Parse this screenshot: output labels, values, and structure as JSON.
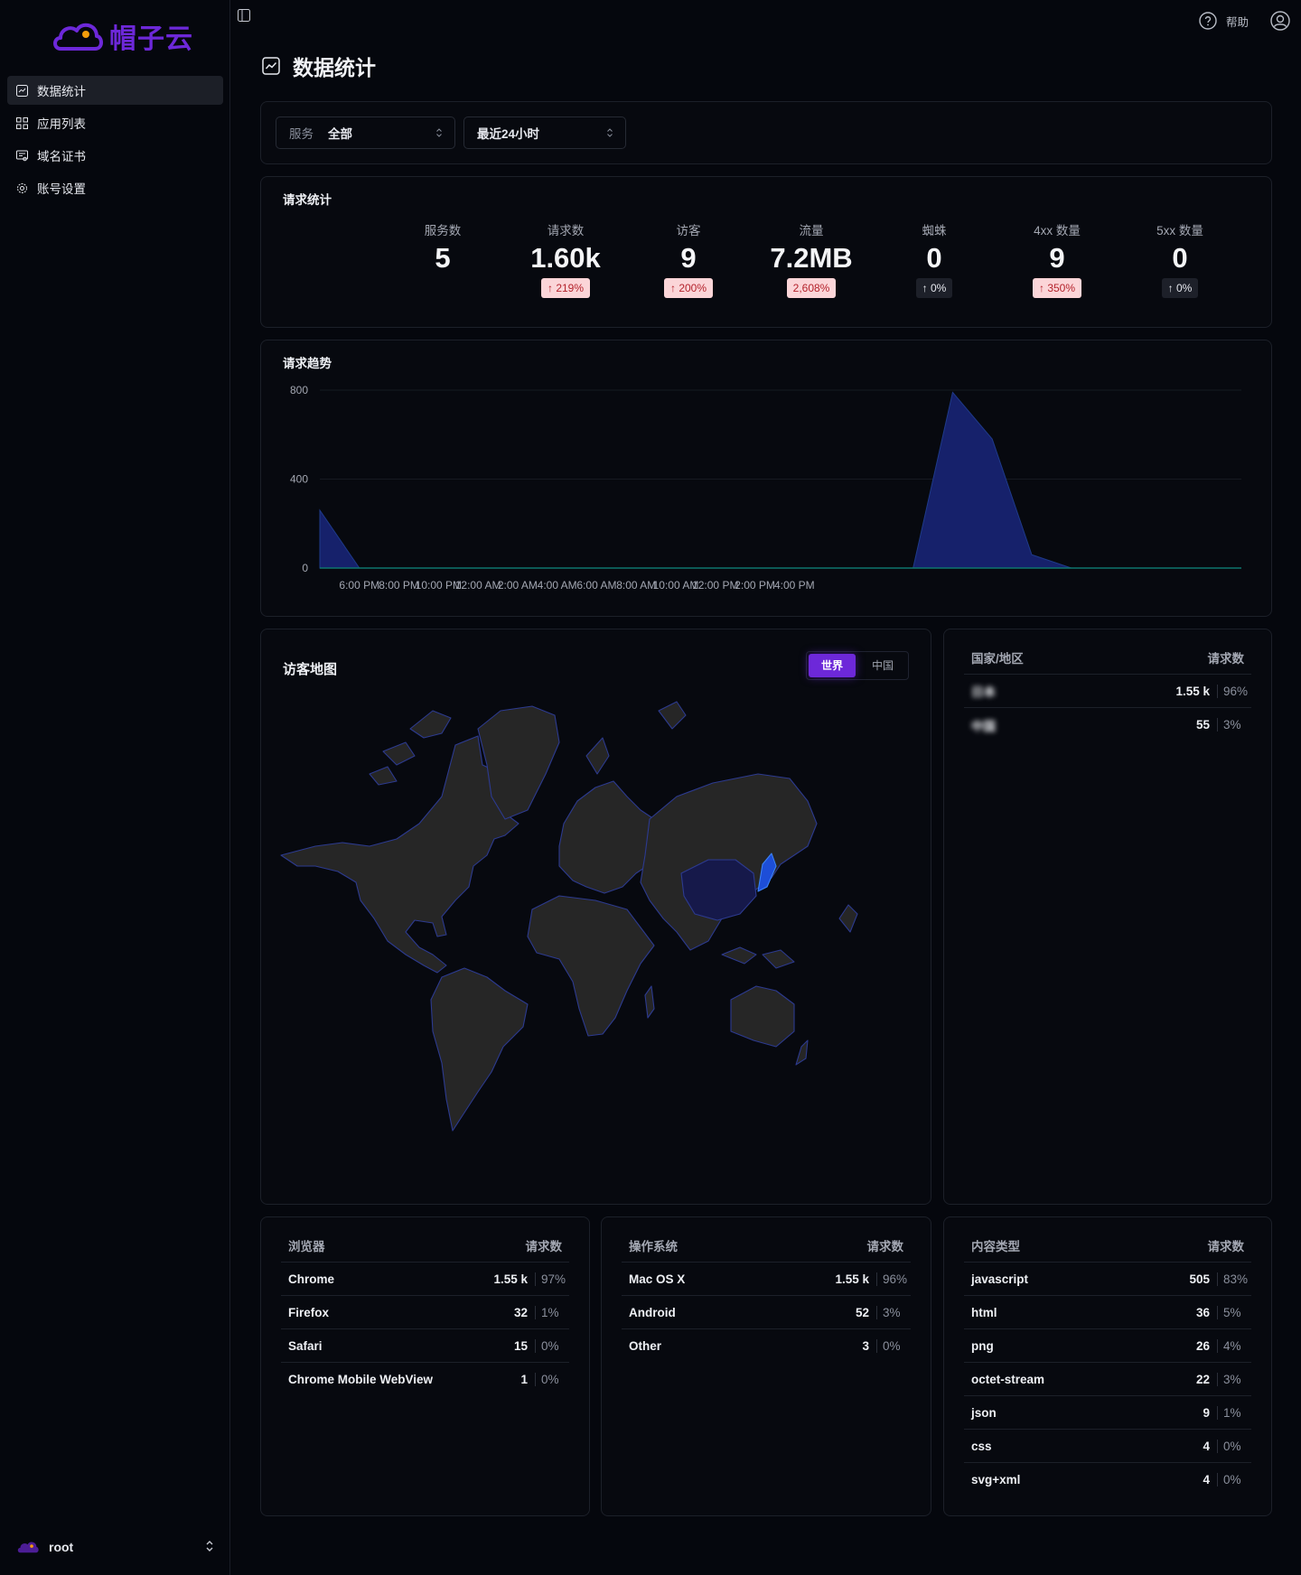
{
  "app": {
    "logo_text": "帽子云"
  },
  "sidebar": {
    "items": [
      {
        "label": "数据统计",
        "icon": "chart-square-icon"
      },
      {
        "label": "应用列表",
        "icon": "grid-icon"
      },
      {
        "label": "域名证书",
        "icon": "certificate-icon"
      },
      {
        "label": "账号设置",
        "icon": "gear-icon"
      }
    ],
    "user": "root"
  },
  "topbar": {
    "help": "帮助"
  },
  "page": {
    "title": "数据统计"
  },
  "filters": {
    "service_label": "服务",
    "service_value": "全部",
    "range_value": "最近24小时"
  },
  "stats": {
    "title": "请求统计",
    "items": [
      {
        "label": "服务数",
        "value": "5",
        "badge": ""
      },
      {
        "label": "请求数",
        "value": "1.60k",
        "badge": "219%",
        "trend": "up"
      },
      {
        "label": "访客",
        "value": "9",
        "badge": "200%",
        "trend": "up"
      },
      {
        "label": "流量",
        "value": "7.2MB",
        "badge": "2,608%",
        "trend": "none"
      },
      {
        "label": "蜘蛛",
        "value": "0",
        "badge": "0%",
        "trend": "zero"
      },
      {
        "label": "4xx 数量",
        "value": "9",
        "badge": "350%",
        "trend": "up"
      },
      {
        "label": "5xx 数量",
        "value": "0",
        "badge": "0%",
        "trend": "zero"
      }
    ]
  },
  "trend": {
    "title": "请求趋势"
  },
  "chart_data": {
    "type": "area",
    "title": "请求趋势",
    "x_ticks": [
      "6:00 PM",
      "8:00 PM",
      "10:00 PM",
      "12:00 AM",
      "2:00 AM",
      "4:00 AM",
      "6:00 AM",
      "8:00 AM",
      "10:00 AM",
      "12:00 PM",
      "2:00 PM",
      "4:00 PM"
    ],
    "y_ticks": [
      "0",
      "400",
      "800"
    ],
    "ylim": [
      0,
      800
    ],
    "xlim": [
      -1,
      22.3
    ],
    "series": [
      {
        "points": [
          [
            -1,
            260
          ],
          [
            0,
            0
          ],
          [
            1,
            0
          ],
          [
            3,
            0
          ],
          [
            5,
            0
          ],
          [
            7,
            0
          ],
          [
            9,
            0
          ],
          [
            14,
            0
          ],
          [
            15,
            790
          ],
          [
            16,
            580
          ],
          [
            17,
            60
          ],
          [
            18,
            0
          ],
          [
            20,
            0
          ],
          [
            22,
            0
          ],
          [
            22.3,
            0
          ]
        ]
      }
    ],
    "grid": true,
    "fill_color": "#16216b",
    "line_color": "#1e3a8a",
    "baseline_color": "#0f766e"
  },
  "map": {
    "title": "访客地图",
    "tabs": [
      "世界",
      "中国"
    ],
    "active_tab": "世界",
    "land_color": "#262626",
    "border_color": "#2c3a8f",
    "highlight_color": "#16194a"
  },
  "country_table": {
    "head": [
      "国家/地区",
      "请求数"
    ],
    "rows": [
      {
        "name": "日本",
        "count": "1.55 k",
        "pct": "96%"
      },
      {
        "name": "中国",
        "count": "55",
        "pct": "3%"
      }
    ]
  },
  "browser_table": {
    "head": [
      "浏览器",
      "请求数"
    ],
    "rows": [
      {
        "name": "Chrome",
        "count": "1.55 k",
        "pct": "97%"
      },
      {
        "name": "Firefox",
        "count": "32",
        "pct": "1%"
      },
      {
        "name": "Safari",
        "count": "15",
        "pct": "0%"
      },
      {
        "name": "Chrome Mobile WebView",
        "count": "1",
        "pct": "0%"
      }
    ]
  },
  "os_table": {
    "head": [
      "操作系统",
      "请求数"
    ],
    "rows": [
      {
        "name": "Mac OS X",
        "count": "1.55 k",
        "pct": "96%"
      },
      {
        "name": "Android",
        "count": "52",
        "pct": "3%"
      },
      {
        "name": "Other",
        "count": "3",
        "pct": "0%"
      }
    ]
  },
  "content_table": {
    "head": [
      "内容类型",
      "请求数"
    ],
    "rows": [
      {
        "name": "javascript",
        "count": "505",
        "pct": "83%"
      },
      {
        "name": "html",
        "count": "36",
        "pct": "5%"
      },
      {
        "name": "png",
        "count": "26",
        "pct": "4%"
      },
      {
        "name": "octet-stream",
        "count": "22",
        "pct": "3%"
      },
      {
        "name": "json",
        "count": "9",
        "pct": "1%"
      },
      {
        "name": "css",
        "count": "4",
        "pct": "0%"
      },
      {
        "name": "svg+xml",
        "count": "4",
        "pct": "0%"
      }
    ]
  }
}
